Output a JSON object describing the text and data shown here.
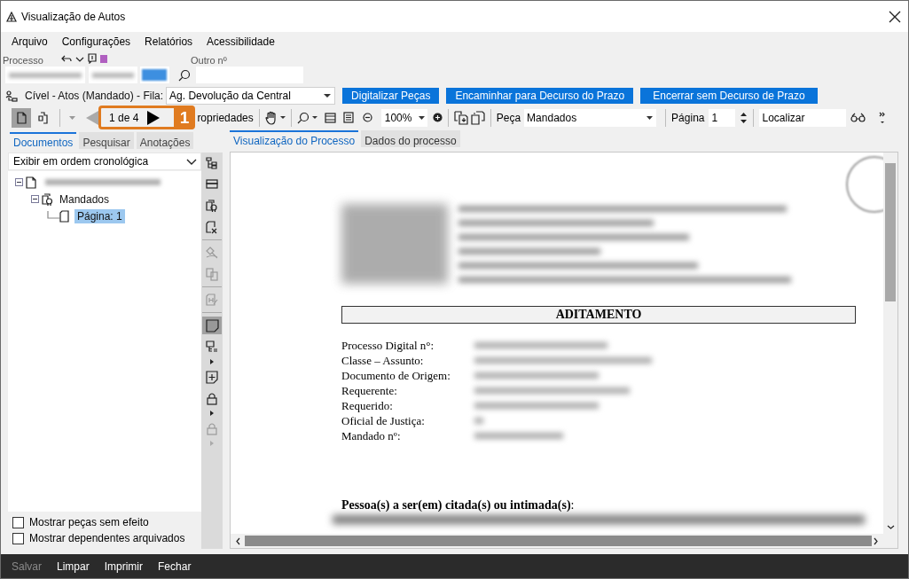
{
  "window": {
    "title": "Visualização de Autos"
  },
  "menu": [
    "Arquivo",
    "Configurações",
    "Relatórios",
    "Acessibilidade"
  ],
  "process": {
    "label": "Processo",
    "other_label": "Outro nº",
    "queue_text": "Cível - Atos (Mandado) - Fila:",
    "queue": "Ag. Devolução da Central"
  },
  "actions": [
    "Digitalizar Peças",
    "Encaminhar para Decurso do Prazo",
    "Encerrar sem Decurso de Prazo"
  ],
  "view_modes": [
    {
      "selected": true
    },
    {
      "selected": false
    }
  ],
  "toolbar": {
    "page_counter": "1 de 4",
    "properties": "ropriedades",
    "zoom": "100%",
    "piece_label": "Peça",
    "piece": "Mandados",
    "page_label": "Página",
    "page": "1",
    "find_placeholder": "Localizar"
  },
  "callout": {
    "number": "1"
  },
  "side_tabs": [
    {
      "label": "Documentos",
      "selected": true
    },
    {
      "label": "Pesquisar",
      "selected": false
    },
    {
      "label": "Anotações",
      "selected": false
    }
  ],
  "order": "Exibir em ordem cronológica",
  "tree": [
    {
      "kind": "redacted",
      "expanded": true,
      "children": [
        {
          "kind": "folder",
          "label": "Mandados",
          "expanded": true,
          "selected": false,
          "children": [
            {
              "kind": "page",
              "label": "Página: 1",
              "selected": true
            }
          ]
        }
      ]
    }
  ],
  "side_tools": [
    {
      "disabled": false,
      "pressed": false
    },
    {
      "disabled": false,
      "pressed": false
    },
    {
      "disabled": false,
      "pressed": false
    },
    {
      "disabled": false,
      "pressed": false
    },
    {
      "disabled": true,
      "pressed": false
    },
    {
      "disabled": true,
      "pressed": false
    },
    {
      "disabled": true,
      "pressed": false
    },
    {
      "disabled": false,
      "pressed": true
    },
    {
      "disabled": false,
      "pressed": false
    },
    {
      "disabled": false,
      "pressed": false
    },
    {
      "disabled": false,
      "pressed": false
    },
    {
      "disabled": true,
      "pressed": false
    }
  ],
  "options": [
    {
      "label": "Mostrar peças sem efeito",
      "checked": false
    },
    {
      "label": "Mostrar dependentes arquivados",
      "checked": false
    }
  ],
  "view_tabs": [
    {
      "label": "Visualização do Processo",
      "selected": true
    },
    {
      "label": "Dados do processo",
      "selected": false
    }
  ],
  "document": {
    "heading": "ADITAMENTO",
    "fields": [
      "Processo Digital n°:",
      "Classe – Assunto:",
      "Documento de Origem:",
      "Requerente:",
      "Requerido:",
      "Oficial de Justiça:",
      "Mandado nº:"
    ],
    "section": "**Pessoa(s) a ser(em) citada(s) ou intimada(s)**:"
  },
  "footer": [
    {
      "label": "Salvar",
      "disabled": true
    },
    {
      "label": "Limpar",
      "disabled": false
    },
    {
      "label": "Imprimir",
      "disabled": false
    },
    {
      "label": "Fechar",
      "disabled": false
    }
  ]
}
